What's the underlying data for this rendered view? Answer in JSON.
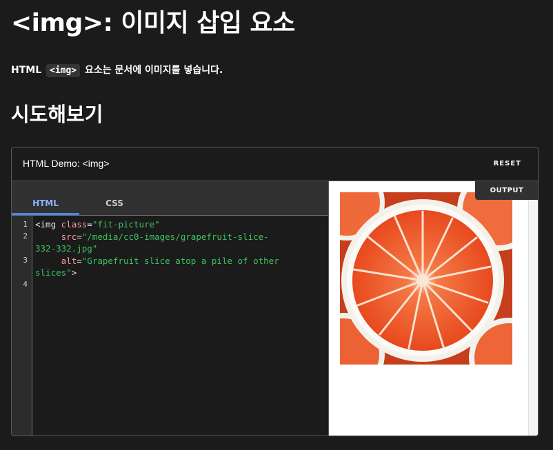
{
  "page": {
    "title": "<img>: 이미지 삽입 요소",
    "intro": {
      "part1": "HTML",
      "code": "<img>",
      "part2": "요소는 문서에 이미지를 넣습니다."
    },
    "subtitle": "시도해보기"
  },
  "demo": {
    "title": "HTML Demo: <img>",
    "reset_label": "RESET",
    "output_label": "OUTPUT",
    "tabs": [
      {
        "label": "HTML",
        "active": true
      },
      {
        "label": "CSS",
        "active": false
      }
    ],
    "line_numbers": [
      "1",
      "2",
      "3",
      "4"
    ],
    "code": {
      "l1": {
        "open": "<img ",
        "attr": "class",
        "eq": "=",
        "val": "\"fit-picture\""
      },
      "l2": {
        "indent": "     ",
        "attr": "src",
        "eq": "=",
        "val": "\"/media/cc0-images/grapefruit-slice-"
      },
      "l2b": {
        "val": "332-332.jpg\""
      },
      "l3": {
        "indent": "     ",
        "attr": "alt",
        "eq": "=",
        "val": "\"Grapefruit slice atop a pile of other"
      },
      "l3b": {
        "val": "slices\"",
        "close": ">"
      }
    }
  },
  "colors": {
    "background": "#1b1b1b",
    "accent_tab": "#8cb4ff",
    "code_attr": "#ff9aa2",
    "code_string": "#3ac45e",
    "fruit": "#f25a2b"
  },
  "icons": {
    "photo": "grapefruit-slice-image"
  }
}
